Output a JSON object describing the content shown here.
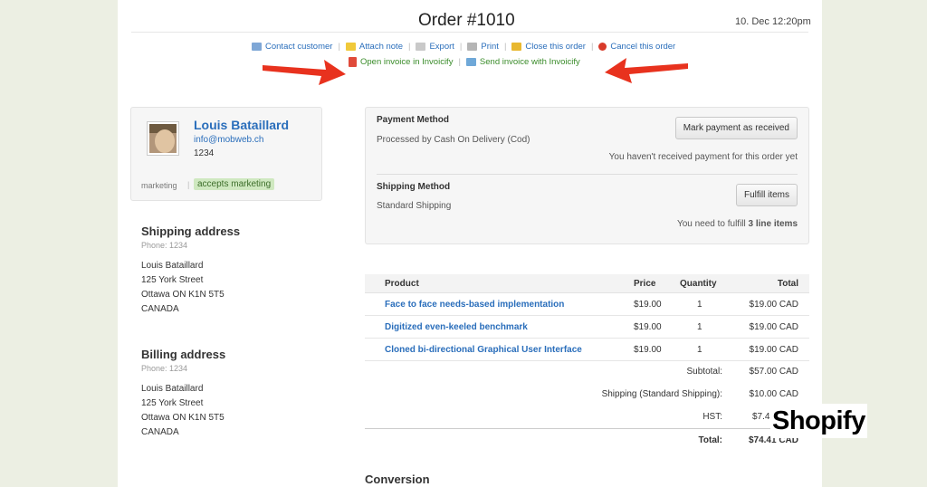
{
  "header": {
    "title": "Order #1010",
    "date": "10. Dec 12:20pm"
  },
  "toolbar": {
    "contact": "Contact customer",
    "attach": "Attach note",
    "export": "Export",
    "print": "Print",
    "close": "Close this order",
    "cancel": "Cancel this order",
    "open_invoice": "Open invoice in Invoicify",
    "send_invoice": "Send invoice with Invoicify"
  },
  "customer": {
    "name": "Louis Bataillard",
    "email": "info@mobweb.ch",
    "phone": "1234",
    "marketing_label": "marketing",
    "marketing_badge": "accepts marketing"
  },
  "shipping_address": {
    "heading": "Shipping address",
    "phone": "Phone: 1234",
    "lines": [
      "Louis Bataillard",
      "125 York Street",
      "Ottawa ON K1N 5T5",
      "CANADA"
    ]
  },
  "billing_address": {
    "heading": "Billing address",
    "phone": "Phone: 1234",
    "lines": [
      "Louis Bataillard",
      "125 York Street",
      "Ottawa ON K1N 5T5",
      "CANADA"
    ]
  },
  "payment": {
    "heading": "Payment Method",
    "method": "Processed by Cash On Delivery (Cod)",
    "button": "Mark payment as received",
    "status": "You haven't received payment for this order yet"
  },
  "shipping": {
    "heading": "Shipping Method",
    "method": "Standard Shipping",
    "button": "Fulfill items",
    "status_prefix": "You need to fulfill",
    "status_bold": "3 line items"
  },
  "table": {
    "headers": [
      "Product",
      "Price",
      "Quantity",
      "Total"
    ],
    "rows": [
      {
        "product": "Face to face needs-based implementation",
        "price": "$19.00",
        "qty": "1",
        "total": "$19.00 CAD"
      },
      {
        "product": "Digitized even-keeled benchmark",
        "price": "$19.00",
        "qty": "1",
        "total": "$19.00 CAD"
      },
      {
        "product": "Cloned bi-directional Graphical User Interface",
        "price": "$19.00",
        "qty": "1",
        "total": "$19.00 CAD"
      }
    ]
  },
  "summary": {
    "subtotal_label": "Subtotal:",
    "subtotal": "$57.00 CAD",
    "shipping_label": "Shipping (Standard Shipping):",
    "shipping": "$10.00 CAD",
    "hst_label": "HST:",
    "hst": "$7.4",
    "total_label": "Total:",
    "total": "$74.41 CAD"
  },
  "conversion_heading": "Conversion",
  "brand": "Shopify",
  "colors": {
    "link": "#2a6ebb",
    "invoicify_link": "#3a8c2a",
    "arrow": "#e8321e",
    "badge_bg": "#cfe8c0"
  }
}
